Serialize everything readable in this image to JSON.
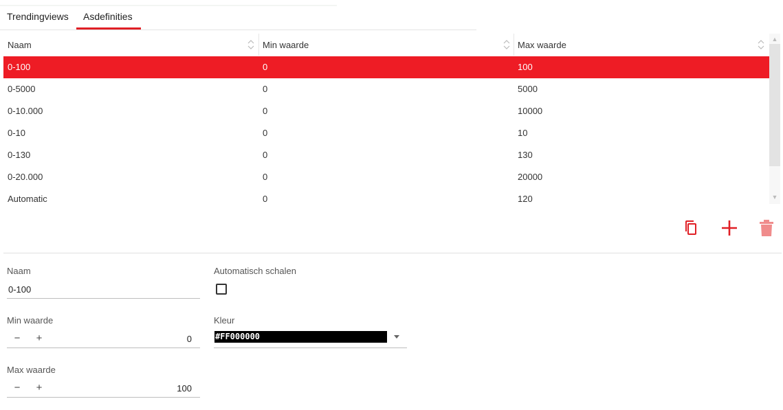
{
  "tabs": [
    {
      "label": "Trendingviews",
      "active": false
    },
    {
      "label": "Asdefinities",
      "active": true
    }
  ],
  "table": {
    "columns": [
      "Naam",
      "Min waarde",
      "Max waarde"
    ],
    "rows": [
      {
        "naam": "0-100",
        "min": "0",
        "max": "100",
        "selected": true
      },
      {
        "naam": "0-5000",
        "min": "0",
        "max": "5000"
      },
      {
        "naam": "0-10.000",
        "min": "0",
        "max": "10000"
      },
      {
        "naam": "0-10",
        "min": "0",
        "max": "10"
      },
      {
        "naam": "0-130",
        "min": "0",
        "max": "130"
      },
      {
        "naam": "0-20.000",
        "min": "0",
        "max": "20000"
      },
      {
        "naam": "Automatic",
        "min": "0",
        "max": "120"
      }
    ]
  },
  "toolbar": {
    "icons": [
      "copy-icon",
      "plus-icon",
      "trash-icon"
    ],
    "accent_color": "#e01f25"
  },
  "form": {
    "naam_label": "Naam",
    "naam_value": "0-100",
    "auto_label": "Automatisch schalen",
    "auto_checked": false,
    "min_label": "Min waarde",
    "min_value": "0",
    "max_label": "Max waarde",
    "max_value": "100",
    "kleur_label": "Kleur",
    "kleur_value": "#FF000000",
    "minus_symbol": "−",
    "plus_symbol": "+"
  },
  "colors": {
    "selected_row": "#ee1c25",
    "tab_accent": "#e01f25"
  }
}
